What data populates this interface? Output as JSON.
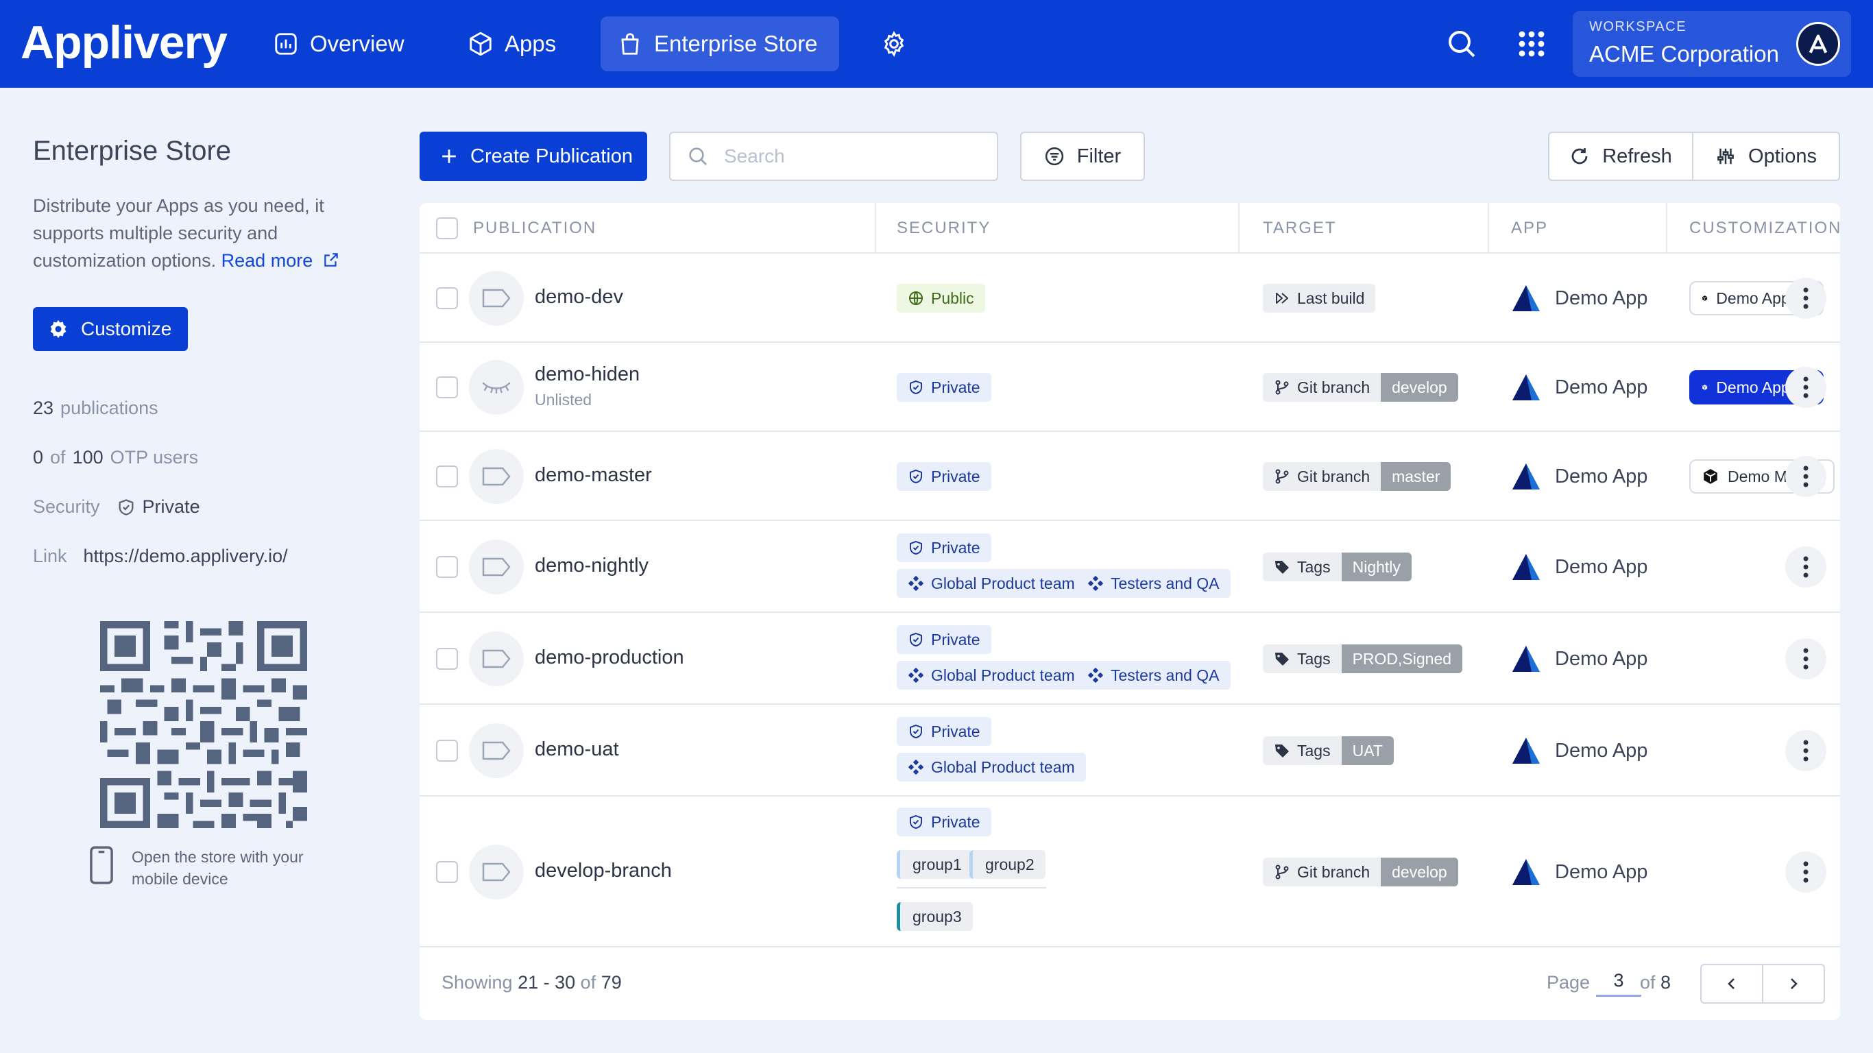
{
  "header": {
    "logo": "Applivery",
    "nav": [
      {
        "label": "Overview"
      },
      {
        "label": "Apps"
      },
      {
        "label": "Enterprise Store"
      }
    ],
    "workspace_label": "WORKSPACE",
    "workspace_name": "ACME Corporation"
  },
  "sidebar": {
    "title": "Enterprise Store",
    "description": "Distribute your Apps as you need, it supports multiple security and customization options.",
    "read_more": "Read more",
    "customize_label": "Customize",
    "publications_count": "23",
    "publications_label": "publications",
    "otp_used": "0",
    "otp_of": "of",
    "otp_total": "100",
    "otp_label": "OTP users",
    "security_label": "Security",
    "security_value": "Private",
    "link_label": "Link",
    "link_value": "https://demo.applivery.io/",
    "qr_note": "Open the store with your mobile device"
  },
  "toolbar": {
    "create_label": "Create Publication",
    "search_placeholder": "Search",
    "filter_label": "Filter",
    "refresh_label": "Refresh",
    "options_label": "Options"
  },
  "table": {
    "columns": [
      "PUBLICATION",
      "SECURITY",
      "TARGET",
      "APP",
      "CUSTOMIZATION"
    ],
    "rows": [
      {
        "name": "demo-dev",
        "sub": "",
        "security": "Public",
        "groups": [],
        "target_key": "Last build",
        "target_value": "",
        "app": "Demo App",
        "custom": "Demo App Dev"
      },
      {
        "name": "demo-hiden",
        "sub": "Unlisted",
        "security": "Private",
        "groups": [],
        "target_key": "Git branch",
        "target_value": "develop",
        "app": "Demo App",
        "custom": "Demo App Dev"
      },
      {
        "name": "demo-master",
        "sub": "",
        "security": "Private",
        "groups": [],
        "target_key": "Git branch",
        "target_value": "master",
        "app": "Demo App",
        "custom": "Demo Master"
      },
      {
        "name": "demo-nightly",
        "sub": "",
        "security": "Private",
        "groups": [
          "Global Product team",
          "Testers and QA"
        ],
        "target_key": "Tags",
        "target_value": "Nightly",
        "app": "Demo App",
        "custom": ""
      },
      {
        "name": "demo-production",
        "sub": "",
        "security": "Private",
        "groups": [
          "Global Product team",
          "Testers and QA"
        ],
        "target_key": "Tags",
        "target_value": "PROD,Signed",
        "app": "Demo App",
        "custom": ""
      },
      {
        "name": "demo-uat",
        "sub": "",
        "security": "Private",
        "groups": [
          "Global Product team"
        ],
        "target_key": "Tags",
        "target_value": "UAT",
        "app": "Demo App",
        "custom": ""
      },
      {
        "name": "develop-branch",
        "sub": "",
        "security": "Private",
        "groups": [
          "group1",
          "group2",
          "group3"
        ],
        "target_key": "Git branch",
        "target_value": "develop",
        "app": "Demo App",
        "custom": ""
      }
    ]
  },
  "footer": {
    "showing_label": "Showing",
    "range": "21 - 30",
    "of_label": "of",
    "total": "79",
    "page_label": "Page",
    "page": "3",
    "page_of": "of",
    "pages": "8"
  }
}
